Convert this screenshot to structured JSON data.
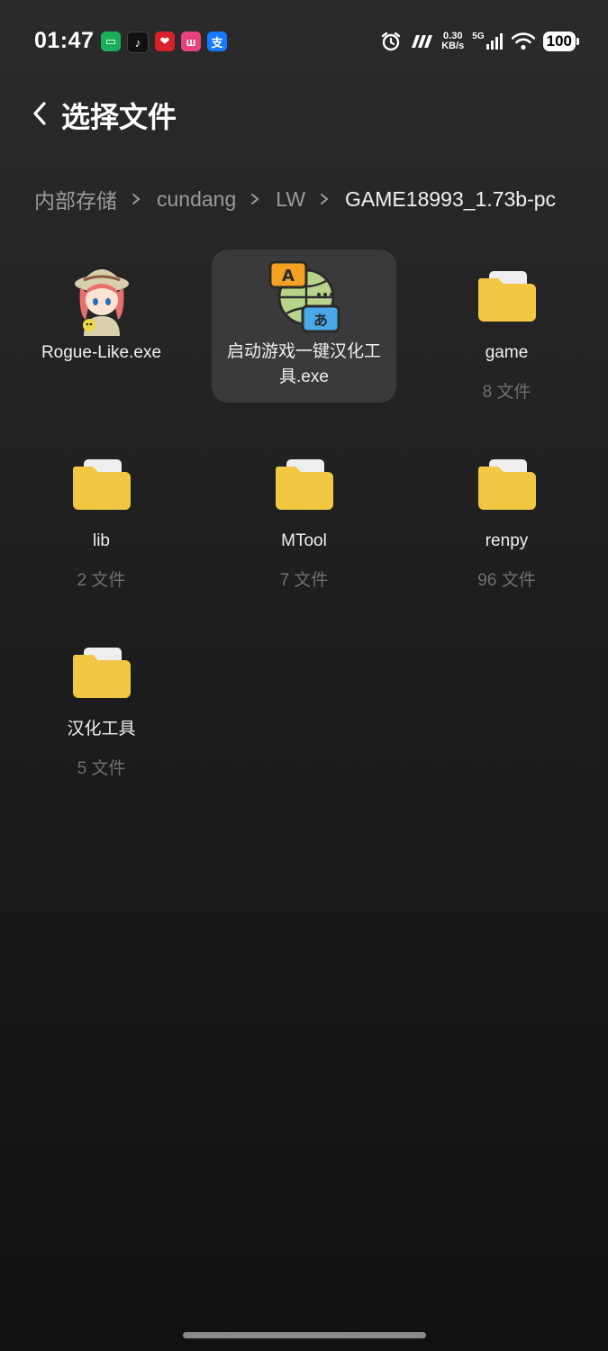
{
  "status_bar": {
    "time": "01:47",
    "notification_icons": [
      "wechat-icon",
      "tiktok-icon",
      "red-app-icon",
      "pink-app-icon",
      "alipay-icon"
    ],
    "net_speed_value": "0.30",
    "net_speed_unit": "KB/s",
    "network_type": "5G",
    "battery": "100"
  },
  "header": {
    "title": "选择文件"
  },
  "breadcrumb": {
    "items": [
      "内部存储",
      "cundang",
      "LW",
      "GAME18993_1.73b-pc"
    ]
  },
  "files": [
    {
      "name": "Rogue-Like.exe",
      "type": "exe",
      "icon": "game-character-icon"
    },
    {
      "name_line1": "启动游戏一键汉化工",
      "name_line2": "具.exe",
      "type": "exe",
      "icon": "translate-icon",
      "selected": true
    },
    {
      "name": "game",
      "count": "8 文件",
      "type": "folder",
      "icon": "folder-icon"
    },
    {
      "name": "lib",
      "count": "2 文件",
      "type": "folder",
      "icon": "folder-icon"
    },
    {
      "name": "MTool",
      "count": "7 文件",
      "type": "folder",
      "icon": "folder-icon"
    },
    {
      "name": "renpy",
      "count": "96 文件",
      "type": "folder",
      "icon": "folder-icon"
    },
    {
      "name": "汉化工具",
      "count": "5 文件",
      "type": "folder",
      "icon": "folder-icon"
    }
  ],
  "colors": {
    "folder": "#f2c744",
    "folder_tab": "#f0f0f0",
    "selected_tile": "#3a3a3a",
    "count_text": "#6f6f6f"
  }
}
